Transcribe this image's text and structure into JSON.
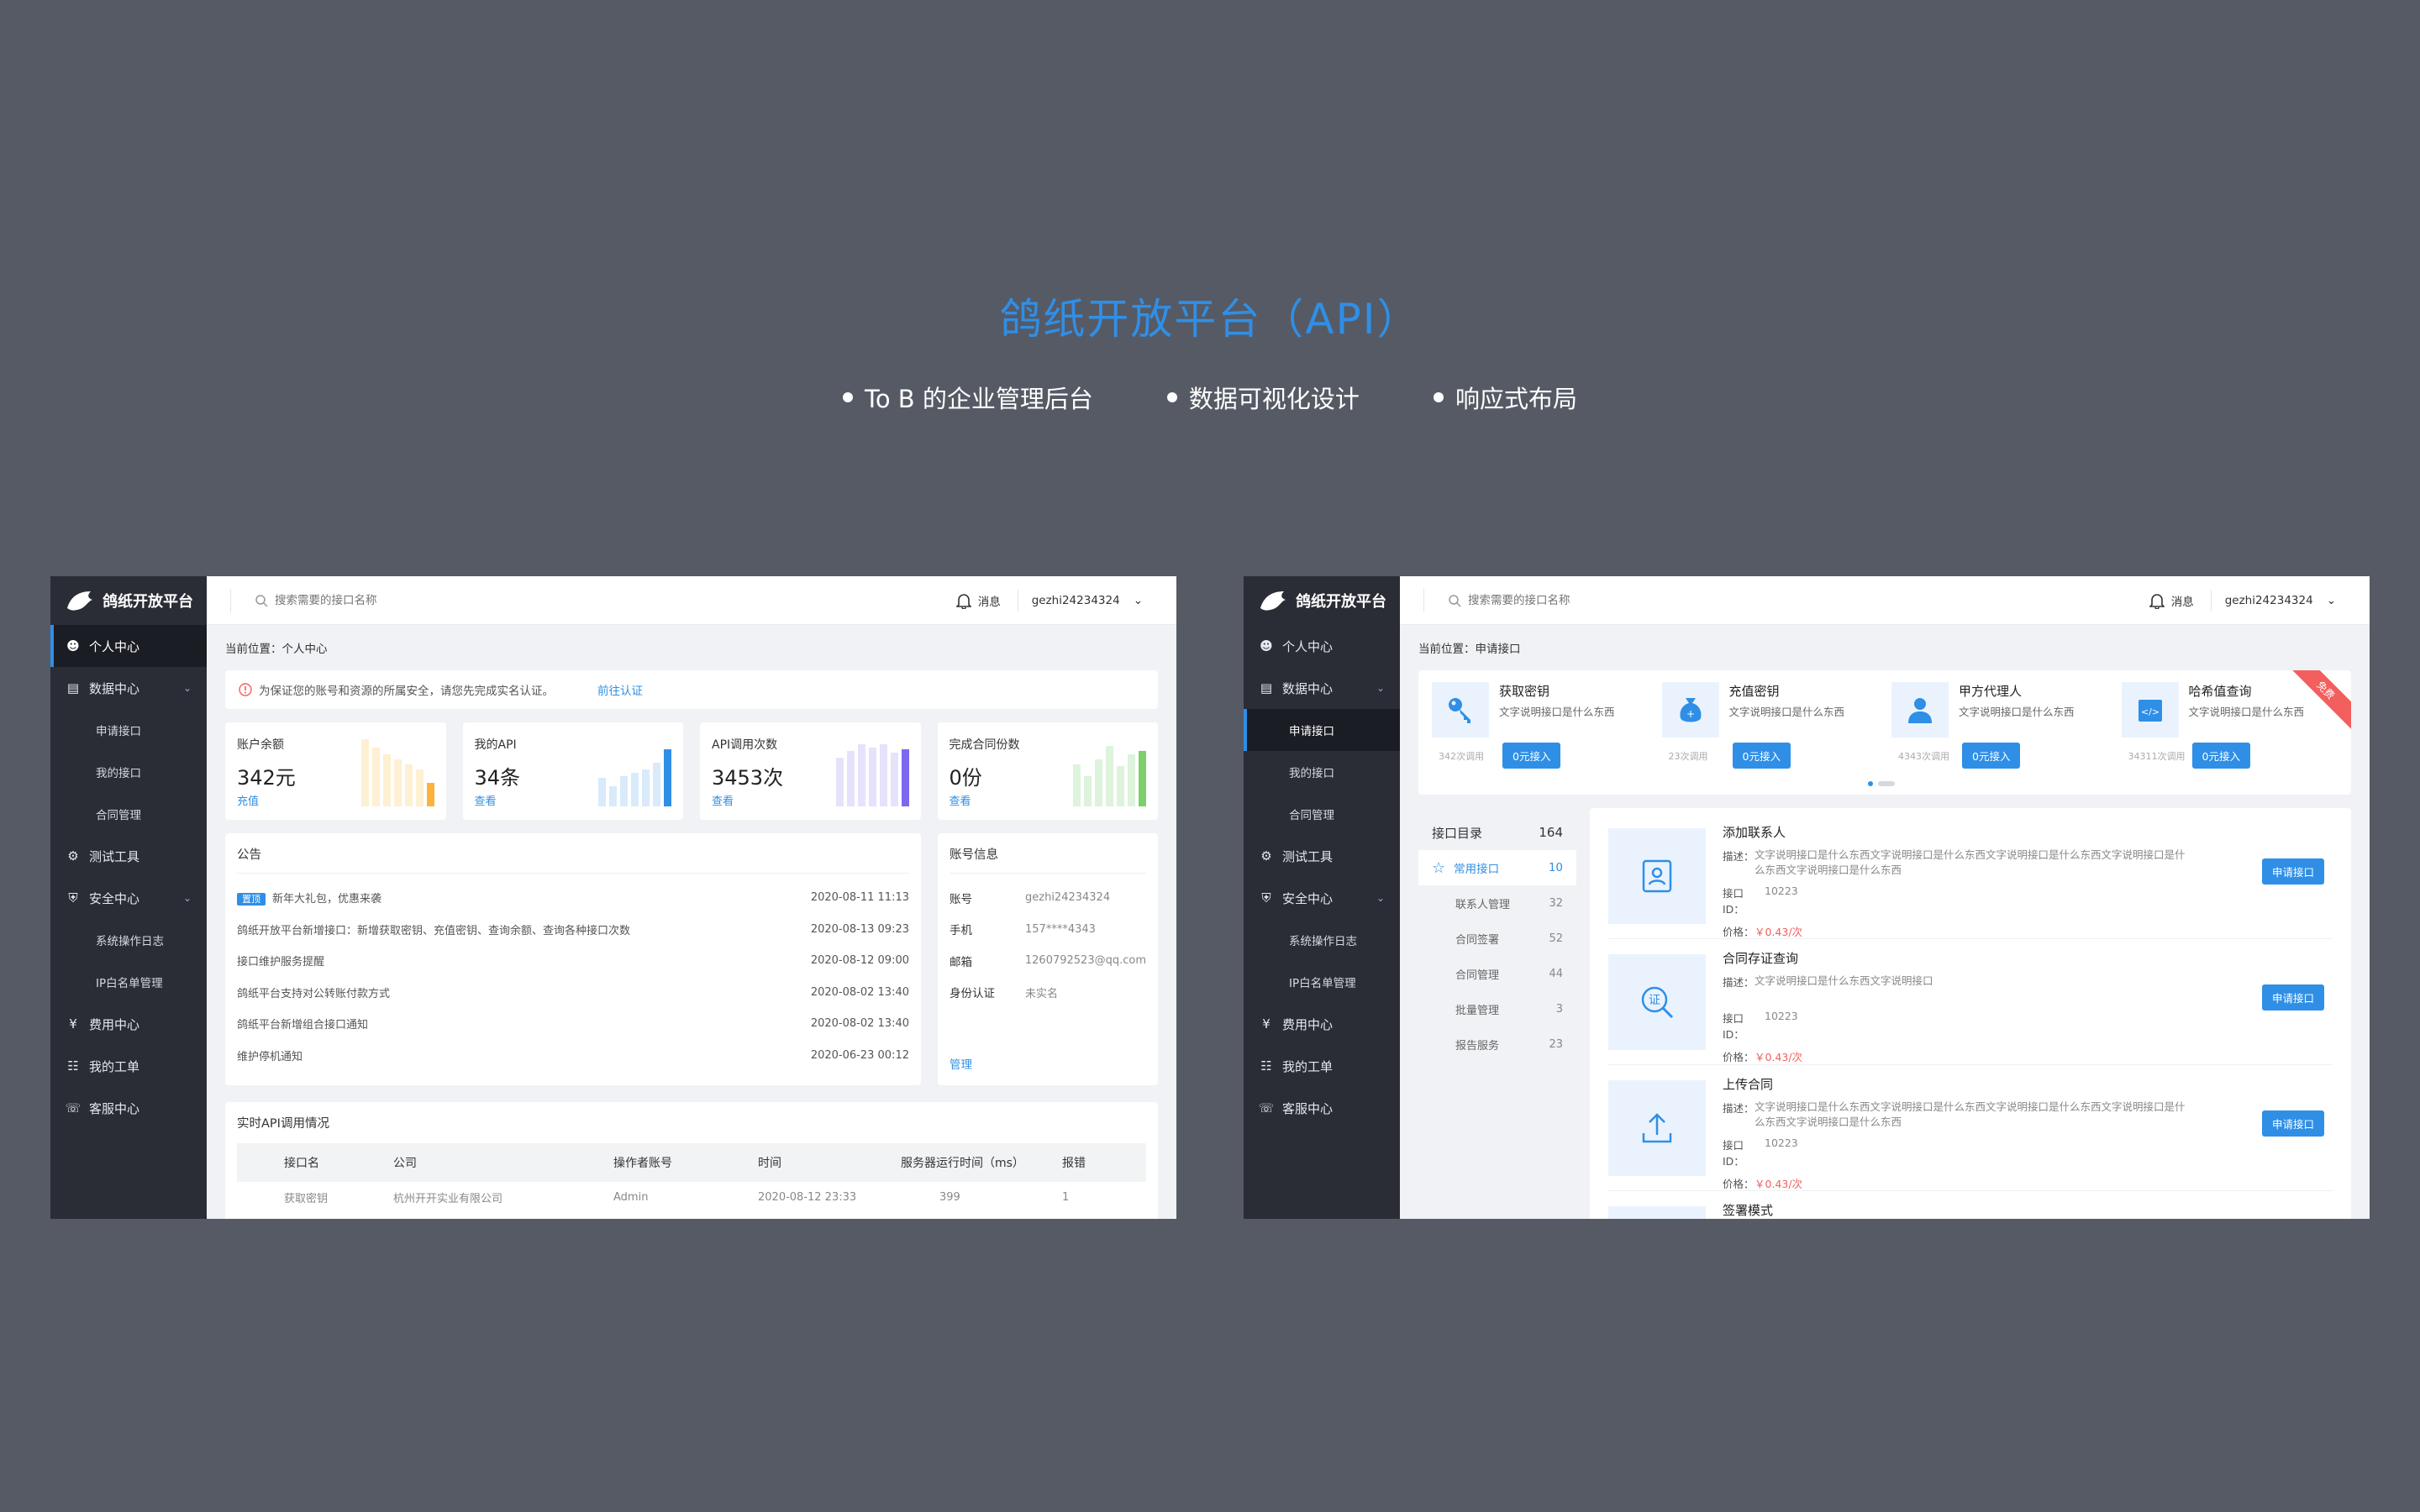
{
  "hero": {
    "title": "鸽纸开放平台（API）",
    "features": [
      "To B 的企业管理后台",
      "数据可视化设计",
      "响应式布局"
    ]
  },
  "app": {
    "logo": "鸽纸开放平台",
    "search_placeholder": "搜索需要的接口名称",
    "msg": "消息",
    "user": "gezhi24234324"
  },
  "nav": {
    "personal": "个人中心",
    "data": "数据中心",
    "apply": "申请接口",
    "mine": "我的接口",
    "contract": "合同管理",
    "test": "测试工具",
    "security": "安全中心",
    "log": "系统操作日志",
    "ip": "IP白名单管理",
    "fee": "费用中心",
    "ticket": "我的工单",
    "service": "客服中心"
  },
  "left": {
    "crumb": "当前位置：个人中心",
    "notice": "为保证您的账号和资源的所属安全，请您先完成实名认证。",
    "notice_link": "前往认证",
    "stats": [
      {
        "label": "账户余额",
        "value": "342元",
        "action": "充值"
      },
      {
        "label": "我的API",
        "value": "34条",
        "action": "查看"
      },
      {
        "label": "API调用次数",
        "value": "3453次",
        "action": "查看"
      },
      {
        "label": "完成合同份数",
        "value": "0份",
        "action": "查看"
      }
    ],
    "announce_title": "公告",
    "announce": [
      {
        "tag": "置顶",
        "text": "新年大礼包，优惠来袭",
        "date": "2020-08-11  11:13"
      },
      {
        "text": "鸽纸开放平台新增接口：新增获取密钥、充值密钥、查询余额、查询各种接口次数",
        "date": "2020-08-13  09:23"
      },
      {
        "text": "接口维护服务提醒",
        "date": "2020-08-12  09:00"
      },
      {
        "text": "鸽纸平台支持对公转账付款方式",
        "date": "2020-08-02  13:40"
      },
      {
        "text": "鸽纸平台新增组合接口通知",
        "date": "2020-08-02  13:40"
      },
      {
        "text": "维护停机通知",
        "date": "2020-06-23  00:12"
      }
    ],
    "account_title": "账号信息",
    "account": [
      {
        "k": "账号",
        "v": "gezhi24234324"
      },
      {
        "k": "手机",
        "v": "157****4343"
      },
      {
        "k": "邮箱",
        "v": "1260792523@qq.com"
      },
      {
        "k": "身份认证",
        "v": "未实名"
      }
    ],
    "manage": "管理",
    "rt_title": "实时API调用情况",
    "rt_cols": [
      "接口名",
      "公司",
      "操作者账号",
      "时间",
      "服务器运行时间（ms）",
      "报错"
    ],
    "rt_row": [
      "获取密钥",
      "杭州开开实业有限公司",
      "Admin",
      "2020-08-12 23:33",
      "399",
      "1"
    ]
  },
  "right": {
    "crumb": "当前位置：申请接口",
    "quick": [
      {
        "title": "获取密钥",
        "desc": "文字说明接口是什么东西",
        "count": "342次调用",
        "btn": "0元接入"
      },
      {
        "title": "充值密钥",
        "desc": "文字说明接口是什么东西",
        "count": "23次调用",
        "btn": "0元接入"
      },
      {
        "title": "甲方代理人",
        "desc": "文字说明接口是什么东西",
        "count": "4343次调用",
        "btn": "0元接入"
      },
      {
        "title": "哈希值查询",
        "desc": "文字说明接口是什么东西",
        "count": "34311次调用",
        "btn": "0元接入"
      }
    ],
    "ribbon": "免费",
    "catalog": {
      "title": "接口目录",
      "total": "164",
      "items": [
        {
          "name": "常用接口",
          "n": "10"
        },
        {
          "name": "联系人管理",
          "n": "32"
        },
        {
          "name": "合同签署",
          "n": "52"
        },
        {
          "name": "合同管理",
          "n": "44"
        },
        {
          "name": "批量管理",
          "n": "3"
        },
        {
          "name": "报告服务",
          "n": "23"
        }
      ]
    },
    "labels": {
      "desc": "描述：",
      "id": "接口ID：",
      "price": "价格：",
      "apply": "申请接口"
    },
    "apis": [
      {
        "title": "添加联系人",
        "desc": "文字说明接口是什么东西文字说明接口是什么东西文字说明接口是什么东西文字说明接口是什么东西文字说明接口是什么东西",
        "id": "10223",
        "price": "￥0.43/次"
      },
      {
        "title": "合同存证查询",
        "desc": "文字说明接口是什么东西文字说明接口",
        "id": "10223",
        "price": "￥0.43/次"
      },
      {
        "title": "上传合同",
        "desc": "文字说明接口是什么东西文字说明接口是什么东西文字说明接口是什么东西文字说明接口是什么东西文字说明接口是什么东西",
        "id": "10223",
        "price": "￥0.43/次"
      },
      {
        "title": "签署模式"
      }
    ]
  }
}
